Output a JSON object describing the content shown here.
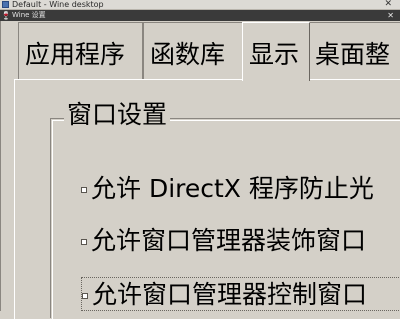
{
  "window": {
    "title": "Default - Wine desktop",
    "close_glyph": "✕"
  },
  "dialog": {
    "title": "Wine 设置",
    "close_glyph": "✕",
    "icon": "wine-glass-icon"
  },
  "tabs": [
    {
      "label": "应用程序",
      "active": false
    },
    {
      "label": "函数库",
      "active": false
    },
    {
      "label": "显示",
      "active": true
    },
    {
      "label": "桌面整",
      "active": false
    }
  ],
  "window_settings": {
    "group_label": "窗口设置",
    "options": [
      {
        "label": "允许 DirectX 程序防止光",
        "checked": false
      },
      {
        "label": "允许窗口管理器装饰窗口",
        "checked": false
      },
      {
        "label": "允许窗口管理器控制窗口",
        "checked": false
      }
    ]
  }
}
